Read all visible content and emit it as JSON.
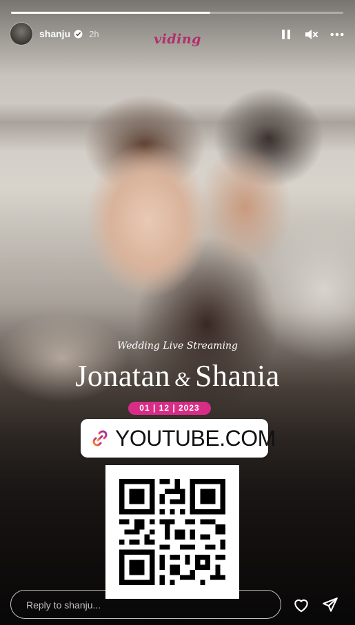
{
  "story": {
    "progress": 0.6,
    "user": {
      "username": "shanju",
      "verified": true,
      "time_ago": "2h"
    },
    "brand_logo_text": "viding",
    "controls": {
      "pause_icon": "pause-icon",
      "mute_icon": "speaker-muted-icon",
      "more_icon": "more-horizontal-icon"
    }
  },
  "card": {
    "event_subtitle": "Wedding Live Streaming",
    "name_left": "Jonatan",
    "ampersand": "&",
    "name_right": "Shania",
    "date": "01 | 12 | 2023",
    "link_sticker": {
      "icon": "link-icon",
      "text": "YOUTUBE.COM"
    },
    "qr_code": "qr-code"
  },
  "reply_bar": {
    "placeholder": "Reply to shanju...",
    "like_icon": "heart-icon",
    "send_icon": "send-icon"
  },
  "colors": {
    "accent_pink": "#d82d86",
    "brand": "#b0306b",
    "verified_blue": "#ffffff"
  }
}
